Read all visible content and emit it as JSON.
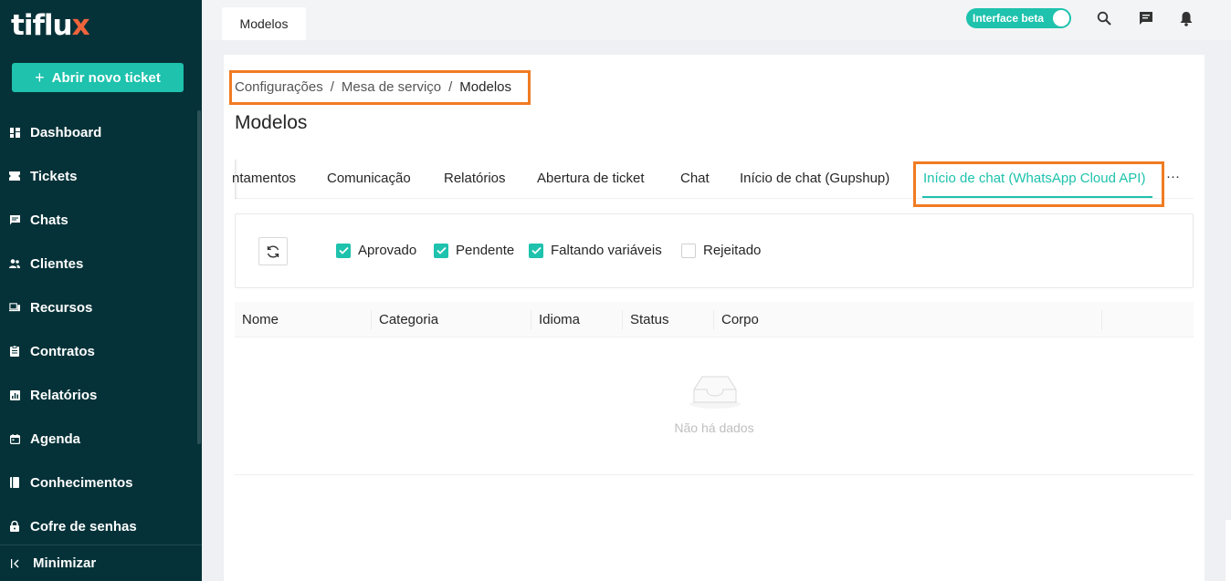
{
  "app": {
    "logo_main": "tiflu",
    "logo_accent": "x",
    "new_ticket_label": "Abrir novo ticket"
  },
  "sidebar": {
    "items": [
      {
        "label": "Dashboard",
        "icon": "dashboard-icon"
      },
      {
        "label": "Tickets",
        "icon": "ticket-icon"
      },
      {
        "label": "Chats",
        "icon": "chat-icon"
      },
      {
        "label": "Clientes",
        "icon": "clients-icon"
      },
      {
        "label": "Recursos",
        "icon": "resources-icon"
      },
      {
        "label": "Contratos",
        "icon": "contract-icon"
      },
      {
        "label": "Relatórios",
        "icon": "reports-icon"
      },
      {
        "label": "Agenda",
        "icon": "calendar-icon"
      },
      {
        "label": "Conhecimentos",
        "icon": "book-icon"
      },
      {
        "label": "Cofre de senhas",
        "icon": "lock-icon"
      }
    ],
    "minimize_label": "Minimizar"
  },
  "topbar": {
    "tab_label": "Modelos",
    "beta_label": "Interface beta"
  },
  "breadcrumb": {
    "items": [
      "Configurações",
      "Mesa de serviço",
      "Modelos"
    ],
    "separator": "/"
  },
  "page": {
    "title": "Modelos"
  },
  "tabs": {
    "items": [
      "ntamentos",
      "Comunicação",
      "Relatórios",
      "Abertura de ticket",
      "Chat",
      "Início de chat (Gupshup)",
      "Início de chat (WhatsApp Cloud API)"
    ],
    "more": "···",
    "active_index": 6
  },
  "filters": {
    "options": [
      {
        "label": "Aprovado",
        "checked": true
      },
      {
        "label": "Pendente",
        "checked": true
      },
      {
        "label": "Faltando variáveis",
        "checked": true
      },
      {
        "label": "Rejeitado",
        "checked": false
      }
    ]
  },
  "table": {
    "columns": [
      "Nome",
      "Categoria",
      "Idioma",
      "Status",
      "Corpo"
    ],
    "empty_text": "Não há dados"
  },
  "colors": {
    "sidebar_bg": "#053238",
    "accent": "#1ec2ad",
    "highlight": "#f07b22"
  }
}
